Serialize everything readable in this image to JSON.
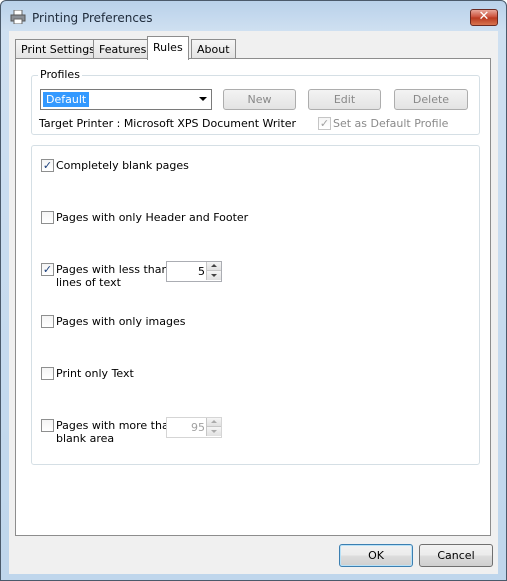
{
  "window": {
    "title": "Printing Preferences",
    "close_label": "✕"
  },
  "tabs": [
    {
      "label": "Print Settings",
      "active": false
    },
    {
      "label": "Features",
      "active": false
    },
    {
      "label": "Rules",
      "active": true
    },
    {
      "label": "About",
      "active": false
    }
  ],
  "profiles": {
    "group_title": "Profiles",
    "selected": "Default",
    "new_label": "New",
    "edit_label": "Edit",
    "delete_label": "Delete",
    "target_printer": "Target Printer : Microsoft XPS Document Writer",
    "set_default_label": "Set as Default Profile",
    "set_default_checked": true
  },
  "rules": {
    "blank_pages": {
      "label": "Completely blank pages",
      "checked": true
    },
    "header_footer": {
      "label": "Pages with only Header and Footer",
      "checked": false
    },
    "less_lines": {
      "label_line1": "Pages with less than",
      "label_line2": "lines of text",
      "checked": true,
      "value": "5"
    },
    "only_images": {
      "label": "Pages with only images",
      "checked": false
    },
    "only_text": {
      "label": "Print only Text",
      "checked": false
    },
    "blank_area": {
      "label_line1": "Pages with more than",
      "label_line2": "blank area",
      "checked": false,
      "value": "95"
    }
  },
  "footer": {
    "ok_label": "OK",
    "cancel_label": "Cancel"
  },
  "colors": {
    "title_bar": "#b9d1ea",
    "selection": "#3399ff",
    "close": "#c94a34"
  },
  "icons": {
    "app": "printer-icon",
    "close": "close-icon",
    "dropdown": "chevron-down-icon"
  }
}
